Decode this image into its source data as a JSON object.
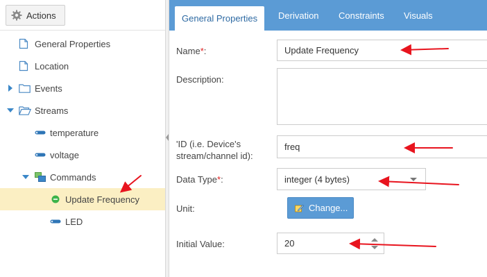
{
  "toolbar": {
    "actions_label": "Actions"
  },
  "tree": {
    "general_properties": "General Properties",
    "location": "Location",
    "events": "Events",
    "streams": "Streams",
    "temperature": "temperature",
    "voltage": "voltage",
    "commands": "Commands",
    "update_frequency": "Update Frequency",
    "led": "LED"
  },
  "tabs": {
    "general": "General Properties",
    "derivation": "Derivation",
    "constraints": "Constraints",
    "visuals": "Visuals"
  },
  "form": {
    "name_label": "Name",
    "name_suffix": ":",
    "required_mark": "*",
    "name_value": "Update Frequency",
    "description_label": "Description:",
    "description_value": "",
    "id_label_line1": "'ID (i.e. Device's",
    "id_label_line2": "stream/channel id):",
    "id_value": "freq",
    "datatype_label": "Data Type",
    "datatype_suffix": ":",
    "datatype_value": "integer (4 bytes)",
    "unit_label": "Unit:",
    "change_label": "Change...",
    "initial_value_label": "Initial Value:",
    "initial_value": "20"
  },
  "colors": {
    "accent": "#5b9bd5",
    "selection": "#fbefc3",
    "annotation": "#e8141e",
    "required": "#e02020"
  }
}
